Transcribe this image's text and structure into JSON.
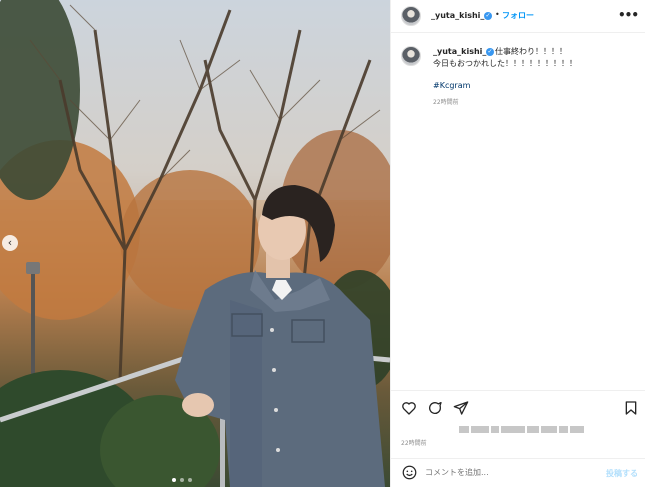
{
  "post": {
    "username": "_yuta_kishi_",
    "follow_label": "フォロー",
    "separator": "•",
    "more_label": "•••",
    "caption_line1": "仕事終わり！！！！",
    "caption_line2": "今日もおつかれした！！！！！！！！！",
    "hashtag": "#Kcgram",
    "caption_time": "22時間前",
    "post_time": "22時間前",
    "comment_placeholder": "コメントを追加...",
    "post_label": "投稿する",
    "carousel": {
      "prev_label": "‹",
      "slides": 3,
      "active": 1
    }
  },
  "colors": {
    "accent": "#0095f6",
    "verified": "#3897f0",
    "post_disabled": "#b2dffc"
  },
  "icons": [
    "heart-icon",
    "comment-icon",
    "share-icon",
    "bookmark-icon",
    "smile-icon",
    "verified-icon"
  ]
}
